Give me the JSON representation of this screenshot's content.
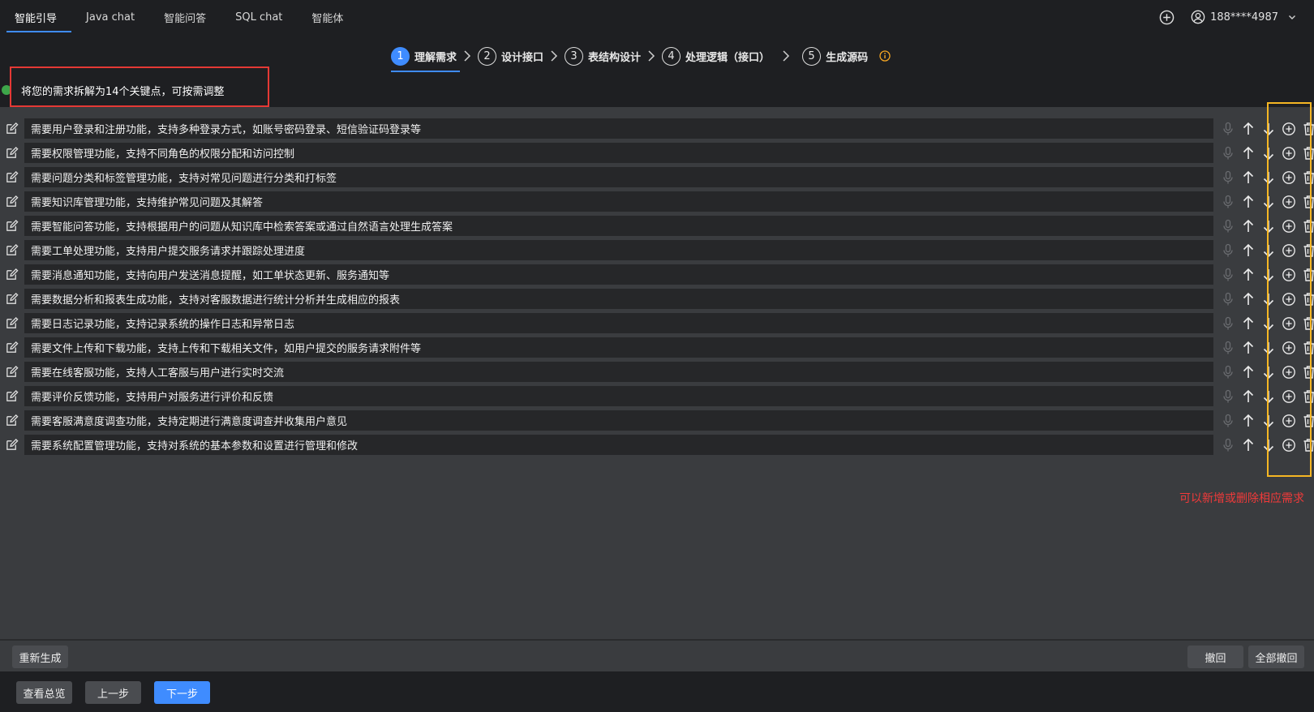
{
  "nav": {
    "tabs": [
      {
        "label": "智能引导",
        "active": true
      },
      {
        "label": "Java chat",
        "active": false
      },
      {
        "label": "智能问答",
        "active": false
      },
      {
        "label": "SQL chat",
        "active": false
      },
      {
        "label": "智能体",
        "active": false
      }
    ],
    "user": {
      "name": "188****4987"
    }
  },
  "steps": [
    {
      "num": "1",
      "label": "理解需求",
      "active": true
    },
    {
      "num": "2",
      "label": "设计接口",
      "active": false
    },
    {
      "num": "3",
      "label": "表结构设计",
      "active": false
    },
    {
      "num": "4",
      "label": "处理逻辑（接口）",
      "active": false
    },
    {
      "num": "5",
      "label": "生成源码",
      "active": false
    }
  ],
  "summary": {
    "text": "将您的需求拆解为14个关键点，可按需调整"
  },
  "requirements": [
    "需要用户登录和注册功能，支持多种登录方式，如账号密码登录、短信验证码登录等",
    "需要权限管理功能，支持不同角色的权限分配和访问控制",
    "需要问题分类和标签管理功能，支持对常见问题进行分类和打标签",
    "需要知识库管理功能，支持维护常见问题及其解答",
    "需要智能问答功能，支持根据用户的问题从知识库中检索答案或通过自然语言处理生成答案",
    "需要工单处理功能，支持用户提交服务请求并跟踪处理进度",
    "需要消息通知功能，支持向用户发送消息提醒，如工单状态更新、服务通知等",
    "需要数据分析和报表生成功能，支持对客服数据进行统计分析并生成相应的报表",
    "需要日志记录功能，支持记录系统的操作日志和异常日志",
    "需要文件上传和下载功能，支持上传和下载相关文件，如用户提交的服务请求附件等",
    "需要在线客服功能，支持人工客服与用户进行实时交流",
    "需要评价反馈功能，支持用户对服务进行评价和反馈",
    "需要客服满意度调查功能，支持定期进行满意度调查并收集用户意见",
    "需要系统配置管理功能，支持对系统的基本参数和设置进行管理和修改"
  ],
  "annotation": {
    "text": "可以新增或删除相应需求"
  },
  "actions": {
    "regenerate": "重新生成",
    "undo": "撤回",
    "undo_all": "全部撤回",
    "overview": "查看总览",
    "prev": "上一步",
    "next": "下一步"
  },
  "colors": {
    "accent": "#3f8cff",
    "highlight_red": "#e53935",
    "highlight_yellow": "#f5b623",
    "status_green": "#3ea64a"
  }
}
